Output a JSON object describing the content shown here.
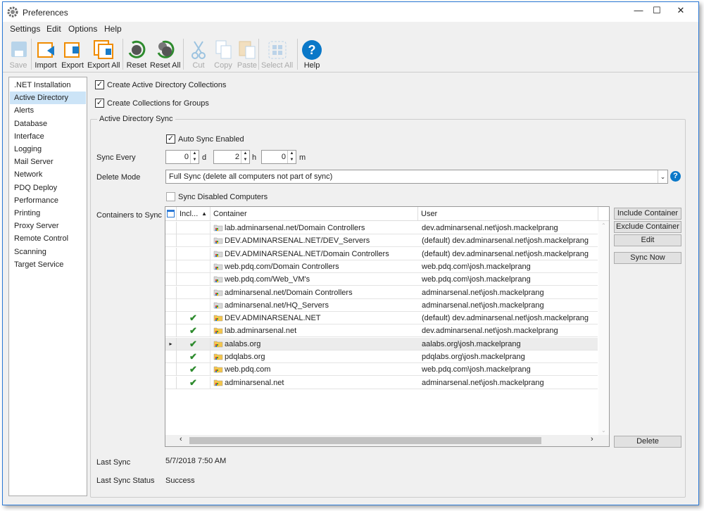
{
  "window": {
    "title": "Preferences",
    "minimize": "—",
    "maximize": "☐",
    "close": "✕"
  },
  "menu": [
    "Settings",
    "Edit",
    "Options",
    "Help"
  ],
  "toolbar": [
    {
      "label": "Save",
      "icon": "save-icon",
      "enabled": false
    },
    {
      "label": "Import",
      "icon": "import-icon",
      "enabled": true
    },
    {
      "label": "Export",
      "icon": "export-icon",
      "enabled": true
    },
    {
      "label": "Export All",
      "icon": "export-all-icon",
      "enabled": true
    },
    {
      "label": "Reset",
      "icon": "reset-icon",
      "enabled": true
    },
    {
      "label": "Reset All",
      "icon": "reset-all-icon",
      "enabled": true
    },
    {
      "label": "Cut",
      "icon": "cut-icon",
      "enabled": false
    },
    {
      "label": "Copy",
      "icon": "copy-icon",
      "enabled": false
    },
    {
      "label": "Paste",
      "icon": "paste-icon",
      "enabled": false
    },
    {
      "label": "Select All",
      "icon": "select-all-icon",
      "enabled": false
    },
    {
      "label": "Help",
      "icon": "help-icon",
      "enabled": true
    }
  ],
  "sidebar": {
    "selected": "Active Directory",
    "items": [
      ".NET Installation",
      "Active Directory",
      "Alerts",
      "Database",
      "Interface",
      "Logging",
      "Mail Server",
      "Network",
      "PDQ Deploy",
      "Performance",
      "Printing",
      "Proxy Server",
      "Remote Control",
      "Scanning",
      "Target Service"
    ]
  },
  "options": {
    "create_collections": "Create Active Directory Collections",
    "create_collections_checked": true,
    "groups": "Create Collections for Groups",
    "groups_checked": true
  },
  "sync": {
    "group_title": "Active Directory Sync",
    "auto_sync": "Auto Sync Enabled",
    "auto_sync_checked": true,
    "sync_every_label": "Sync Every",
    "days": "0",
    "days_unit": "d",
    "hours": "2",
    "hours_unit": "h",
    "minutes": "0",
    "minutes_unit": "m",
    "delete_mode_label": "Delete Mode",
    "delete_mode": "Full Sync (delete all computers not part of sync)",
    "sync_disabled": "Sync Disabled Computers",
    "sync_disabled_checked": false,
    "containers_label": "Containers to Sync",
    "last_sync_label": "Last Sync",
    "last_sync": "5/7/2018 7:50 AM",
    "last_status_label": "Last Sync Status",
    "last_status": "Success"
  },
  "grid": {
    "columns": [
      "Incl...",
      "Container",
      "User"
    ],
    "sort": "Incl... ascending",
    "rows": [
      {
        "inc": false,
        "container": "lab.adminarsenal.net/Domain Controllers",
        "user": "dev.adminarsenal.net\\josh.mackelprang"
      },
      {
        "inc": false,
        "container": "DEV.ADMINARSENAL.NET/DEV_Servers",
        "user": "(default)  dev.adminarsenal.net\\josh.mackelprang"
      },
      {
        "inc": false,
        "container": "DEV.ADMINARSENAL.NET/Domain Controllers",
        "user": "(default)  dev.adminarsenal.net\\josh.mackelprang"
      },
      {
        "inc": false,
        "container": "web.pdq.com/Domain Controllers",
        "user": "web.pdq.com\\josh.mackelprang"
      },
      {
        "inc": false,
        "container": "web.pdq.com/Web_VM's",
        "user": "web.pdq.com\\josh.mackelprang"
      },
      {
        "inc": false,
        "container": "adminarsenal.net/Domain Controllers",
        "user": "adminarsenal.net\\josh.mackelprang"
      },
      {
        "inc": false,
        "container": "adminarsenal.net/HQ_Servers",
        "user": "adminarsenal.net\\josh.mackelprang"
      },
      {
        "inc": true,
        "container": "DEV.ADMINARSENAL.NET",
        "user": "(default)  dev.adminarsenal.net\\josh.mackelprang"
      },
      {
        "inc": true,
        "container": "lab.adminarsenal.net",
        "user": "dev.adminarsenal.net\\josh.mackelprang"
      },
      {
        "inc": true,
        "container": "aalabs.org",
        "user": "aalabs.org\\josh.mackelprang",
        "current": true
      },
      {
        "inc": true,
        "container": "pdqlabs.org",
        "user": "pdqlabs.org\\josh.mackelprang"
      },
      {
        "inc": true,
        "container": "web.pdq.com",
        "user": "web.pdq.com\\josh.mackelprang"
      },
      {
        "inc": true,
        "container": "adminarsenal.net",
        "user": "adminarsenal.net\\josh.mackelprang"
      }
    ]
  },
  "buttons": {
    "include": "Include Container",
    "exclude": "Exclude Container",
    "edit": "Edit",
    "sync_now": "Sync Now",
    "delete": "Delete"
  },
  "colors": {
    "accent": "#2b79d6",
    "selection": "#cce4f7",
    "check": "#2e8b2e",
    "help": "#0a78c8"
  }
}
